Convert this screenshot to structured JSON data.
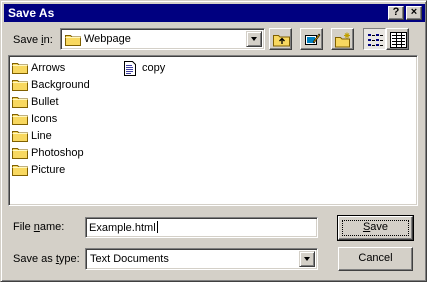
{
  "window": {
    "title": "Save As",
    "help_button": "?",
    "close_button": "×"
  },
  "toolbar": {
    "save_in_prefix": "Save ",
    "save_in_accel": "i",
    "save_in_suffix": "n:",
    "location": "Webpage",
    "location_icon": "folder-icon",
    "buttons": [
      {
        "name": "up-one-level",
        "icon": "up-folder-icon"
      },
      {
        "name": "desktop",
        "icon": "desktop-icon"
      },
      {
        "name": "new-folder",
        "icon": "new-folder-icon"
      },
      {
        "name": "list-view",
        "icon": "list-view-icon",
        "pressed": true
      },
      {
        "name": "details-view",
        "icon": "details-view-icon",
        "pressed": false
      }
    ]
  },
  "files": {
    "folders": [
      "Arrows",
      "Background",
      "Bullet",
      "Icons",
      "Line",
      "Photoshop",
      "Picture"
    ],
    "documents": [
      "copy"
    ]
  },
  "form": {
    "filename_prefix": "File ",
    "filename_accel": "n",
    "filename_suffix": "ame:",
    "filename_value": "Example.html",
    "type_prefix": "Save as ",
    "type_accel": "t",
    "type_suffix": "ype:",
    "type_value": "Text Documents"
  },
  "buttons": {
    "save_accel": "S",
    "save_rest": "ave",
    "cancel": "Cancel"
  },
  "colors": {
    "titlebar": "#000080",
    "face": "#d4d0c8",
    "folder": "#f8d860"
  }
}
